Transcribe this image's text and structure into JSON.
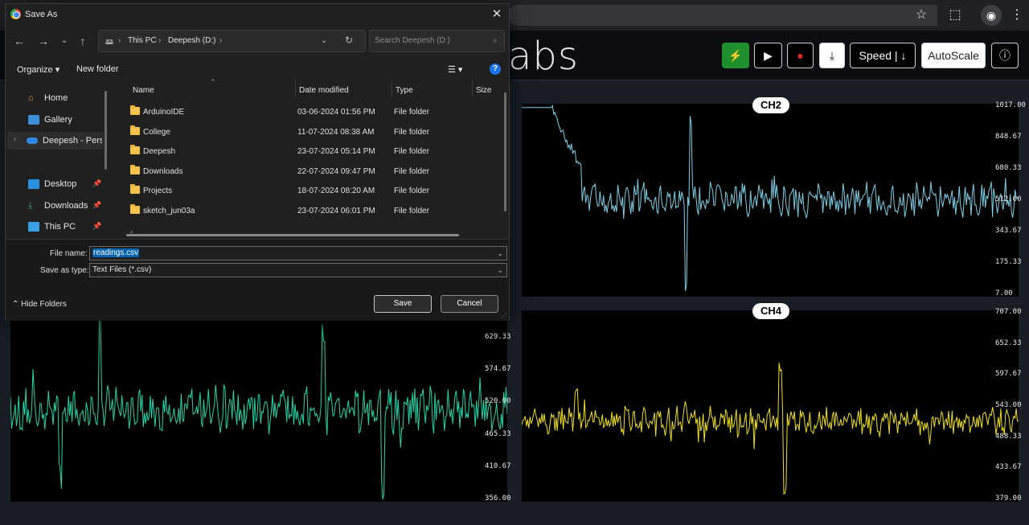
{
  "browser": {
    "icons": [
      "star-icon",
      "extensions-icon",
      "menu-icon"
    ],
    "avatar_glyph": "◉",
    "menu_glyph": "⋮",
    "star_glyph": "☆",
    "ext_glyph": "⬚"
  },
  "app": {
    "brand_partial": "abs",
    "buttons": {
      "speed": "Speed | ↓",
      "autoscale": "AutoScale",
      "info": "ⓘ",
      "download": "⤓",
      "play": "▶",
      "record": "●",
      "usb": "⚡"
    }
  },
  "charts": [
    {
      "label": "CH2",
      "color": "#7fd0e6",
      "ticks": [
        "1017.00",
        "848.67",
        "680.33",
        "512.00",
        "343.67",
        "175.33",
        "7.00"
      ]
    },
    {
      "label": "CH4",
      "color": "#f2e21b",
      "ticks": [
        "707.00",
        "652.33",
        "597.67",
        "543.00",
        "488.33",
        "433.67",
        "379.00"
      ]
    },
    {
      "label": "",
      "color": "#22d6a6",
      "ticks": [
        "629.33",
        "574.67",
        "520.00",
        "465.33",
        "410.67",
        "356.00"
      ]
    }
  ],
  "dialog": {
    "title": "Save As",
    "close": "✕",
    "breadcrumb": [
      "This PC",
      "Deepesh (D:)"
    ],
    "search_placeholder": "Search Deepesh (D:)",
    "organize": "Organize",
    "new_folder": "New folder",
    "nav": [
      {
        "label": "Home",
        "pinned": false
      },
      {
        "label": "Gallery",
        "pinned": false
      },
      {
        "label": "Deepesh - Perso",
        "pinned": false
      },
      {
        "label": "Desktop",
        "pinned": true
      },
      {
        "label": "Downloads",
        "pinned": true
      },
      {
        "label": "This PC",
        "pinned": true
      }
    ],
    "columns": {
      "name": "Name",
      "date": "Date modified",
      "type": "Type",
      "size": "Size"
    },
    "rows": [
      {
        "name": "ArduinoIDE",
        "date": "03-06-2024 01:56 PM",
        "type": "File folder"
      },
      {
        "name": "College",
        "date": "11-07-2024 08:38 AM",
        "type": "File folder"
      },
      {
        "name": "Deepesh",
        "date": "23-07-2024 05:14 PM",
        "type": "File folder"
      },
      {
        "name": "Downloads",
        "date": "22-07-2024 09:47 PM",
        "type": "File folder"
      },
      {
        "name": "Projects",
        "date": "18-07-2024 08:20 AM",
        "type": "File folder"
      },
      {
        "name": "sketch_jun03a",
        "date": "23-07-2024 06:01 PM",
        "type": "File folder"
      }
    ],
    "file_name_label": "File name:",
    "file_name_value": "readings.csv",
    "save_type_label": "Save as type:",
    "save_type_value": "Text Files (*.csv)",
    "hide_folders": "Hide Folders",
    "save": "Save",
    "cancel": "Cancel"
  }
}
